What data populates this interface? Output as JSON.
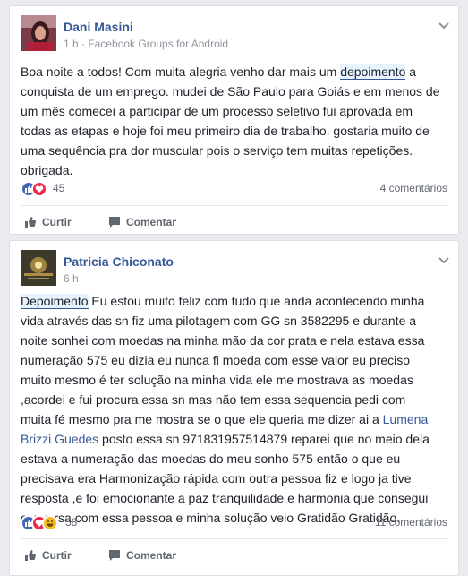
{
  "posts": [
    {
      "author": "Dani Masini",
      "meta": "1 h · Facebook Groups for Android",
      "text_lines": [
        [
          "Boa noite a todos! Com muita alegria venho dar mais um ",
          "depoimento",
          " a"
        ],
        "conquista de um emprego. mudei de São Paulo para Goiás e em menos de",
        "um mês comecei a participar de um processo seletivo fui aprovada em",
        "todas as etapas e hoje foi meu primeiro dia de trabalho. gostaria muito de",
        "uma sequência pra dor muscular pois o serviço tem muitas repetições.",
        "obrigada."
      ],
      "reaction_count": "45",
      "comments": "4 comentários",
      "like_label": "Curtir",
      "comment_label": "Comentar"
    },
    {
      "author": "Patricia Chiconato",
      "meta": "6 h",
      "text_lines": [
        [
          "Depoimento",
          " Eu estou muito feliz com tudo que anda acontecendo minha"
        ],
        "vida através das sn fiz uma pilotagem com GG sn 3582295 e durante a",
        "noite sonhei com moedas na minha mão da cor prata e nela estava essa",
        "numeração 575 eu dizia eu nunca fi moeda com esse valor eu preciso",
        "muito mesmo é ter solução na minha vida ele me mostrava as moedas",
        ",acordei e fui procura essa sn mas não tem essa sequencia pedi com",
        [
          "muita fé mesmo pra me mostra se o que ele queria me dizer ai a ",
          "Lumena",
          ""
        ],
        [
          "Brizzi Guedes",
          " posto essa sn 971831957514879 reparei que no meio dela"
        ],
        "estava a numeração das moedas do meu sonho 575 então o que eu",
        "precisava era Harmonização rápida com outra pessoa fiz e logo ja tive",
        "resposta ,e foi emocionante a paz tranquilidade e harmonia que consegui",
        "conversa com essa pessoa e minha solução veio Gratidão Gratidão."
      ],
      "reaction_count": "58",
      "comments": "11 comentários",
      "like_label": "Curtir",
      "comment_label": "Comentar"
    }
  ],
  "colors": {
    "link": "#365899",
    "like_blue": "#4267b2",
    "love_red": "#f0284a",
    "haha_yellow": "#f7b928"
  }
}
